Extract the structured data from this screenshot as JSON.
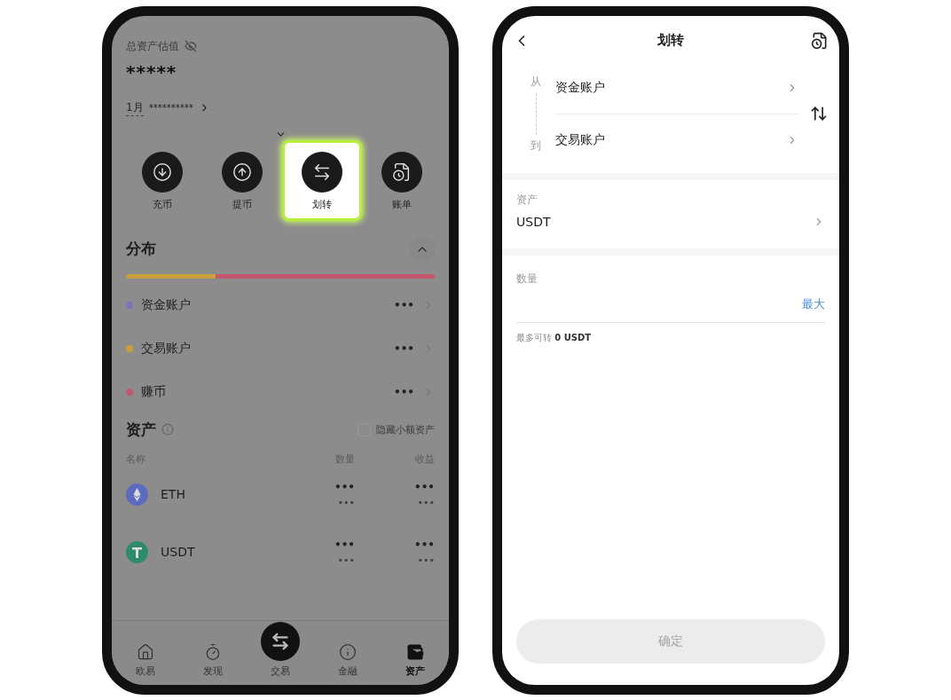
{
  "assets_screen": {
    "total_label": "总资产估值",
    "total_value": "*****",
    "month_label": "1月",
    "month_value": "**********",
    "actions": [
      {
        "label": "充币",
        "highlighted": false
      },
      {
        "label": "提币",
        "highlighted": false
      },
      {
        "label": "划转",
        "highlighted": true
      },
      {
        "label": "账单",
        "highlighted": false
      }
    ],
    "distribution": {
      "title": "分布",
      "expanded": true,
      "bar": [
        {
          "level": 0.29,
          "color": "#c9a03a"
        },
        {
          "level": 0.71,
          "color": "#c4566e"
        }
      ],
      "accounts": [
        {
          "name": "资金账户",
          "value": "•••",
          "color": "#7d72b8"
        },
        {
          "name": "交易账户",
          "value": "•••",
          "color": "#c9a03a"
        },
        {
          "name": "赚币",
          "value": "•••",
          "color": "#c4566e"
        }
      ]
    },
    "assets": {
      "title": "资产",
      "hide_small": {
        "label": "隐藏小额资产",
        "checked": false
      },
      "columns": [
        "名称",
        "数量",
        "收益"
      ],
      "rows": [
        {
          "name": "ETH",
          "amount": "•••",
          "amount_sub": "•••",
          "earnings": "•••",
          "earnings_sub": "•••",
          "color": "#5c6bc0"
        },
        {
          "name": "USDT",
          "amount": "•••",
          "amount_sub": "•••",
          "earnings": "•••",
          "earnings_sub": "•••",
          "color": "#2e8b6a"
        }
      ]
    },
    "nav": [
      {
        "label": "欧易",
        "selected": false
      },
      {
        "label": "发现",
        "selected": false
      },
      {
        "label": "交易",
        "selected": false
      },
      {
        "label": "金融",
        "selected": false
      },
      {
        "label": "资产",
        "selected": true
      }
    ]
  },
  "transfer_screen": {
    "title": "划转",
    "from_label": "从",
    "from_account": "资金账户",
    "to_label": "到",
    "to_account": "交易账户",
    "asset_label": "资产",
    "asset_value": "USDT",
    "amount_label": "数量",
    "max_link": "最大",
    "available": "最多可转 **0 USDT**",
    "confirm": {
      "label": "确定",
      "disabled": true
    }
  }
}
